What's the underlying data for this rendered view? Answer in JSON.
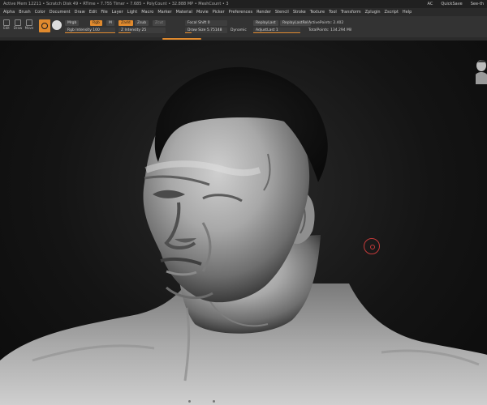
{
  "status_bar": {
    "stats": "Active Mem 12211 • Scratch Disk 49 • RTime • 7.755 Timer • 7.685 • PolyCount • 32.888 MP • MeshCount • 3",
    "ac": "AC",
    "quicksave": "QuickSave",
    "see_through": "See-th"
  },
  "menu": [
    "Alpha",
    "Brush",
    "Color",
    "Document",
    "Draw",
    "Edit",
    "File",
    "Layer",
    "Light",
    "Macro",
    "Marker",
    "Material",
    "Movie",
    "Picker",
    "Preferences",
    "Render",
    "Stencil",
    "Stroke",
    "Texture",
    "Tool",
    "Transform",
    "Zplugin",
    "Zscript",
    "Help"
  ],
  "toolbar": {
    "tools": [
      "Edit",
      "Draw",
      "Move",
      "Scale",
      "Rotate"
    ],
    "mrgb": "Mrgb",
    "rgb": "Rgb",
    "m": "M",
    "zadd": "Zadd",
    "zsub": "Zsub",
    "zcut": "Zcut",
    "rgb_intensity": "Rgb Intensity 100",
    "z_intensity": "Z Intensity 25",
    "focal_shift": "Focal Shift 0",
    "draw_size": "Draw Size 5.75148",
    "dynamic": "Dynamic",
    "replay_last": "ReplayLast",
    "replay_last_rel": "ReplayLastRel",
    "active_points": "ActivePoints: 2.402",
    "adjust_last": "AdjustLast 1",
    "total_points": "TotalPoints: 134.294 Mil"
  },
  "colors": {
    "accent": "#e08a2e",
    "cursor": "#c23a3a",
    "background": "#141414"
  },
  "icons": [
    "brush-cursor-icon",
    "view-gizmo-icon",
    "sphere-material-icon"
  ]
}
